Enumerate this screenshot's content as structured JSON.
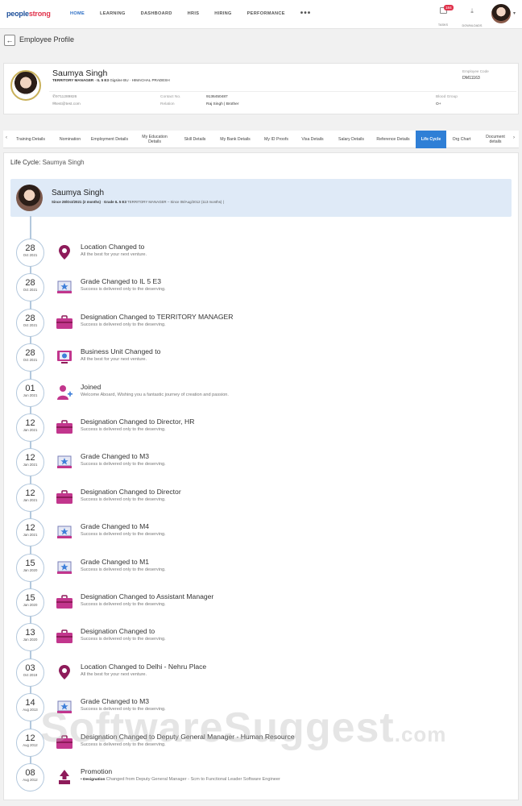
{
  "brand": {
    "logo_a": "people",
    "logo_b": "strong"
  },
  "nav": {
    "items": [
      "HOME",
      "LEARNING",
      "DASHBOARD",
      "HRIS",
      "HIRING",
      "PERFORMANCE"
    ],
    "more": "•••"
  },
  "header_actions": {
    "tasks_label": "TASKS",
    "tasks_count": "184",
    "downloads_label": "DOWNLOADS"
  },
  "page": {
    "title": "Employee Profile"
  },
  "profile": {
    "name": "Saumya Singh",
    "role": "TERRITORY MANAGER · IL 5 E3",
    "role_rest": "Gigsine BU · HIMACHAL PRADESH",
    "code_label": "Employee Code",
    "code": "DM11163",
    "phone": "9711289826",
    "email": "test@test.com",
    "contact_label": "Contact No.",
    "contact": "9136450487",
    "relation_label": "Relation",
    "relation": "Raj Singh | Brother",
    "blood_label": "Blood Group",
    "blood": "O+"
  },
  "tabs": [
    "Training Details",
    "Nomination",
    "Employment Details",
    "My Education Details",
    "Skill Details",
    "My Bank Details",
    "My ID Proofs",
    "Visa Details",
    "Salary Details",
    "Reference Details",
    "Life Cycle",
    "Org Chart",
    "Document details"
  ],
  "lifecycle": {
    "label": "Life Cycle:",
    "name": "Saumya Singh",
    "header_name": "Saumya Singh",
    "since1": "Since 28/Oct/2021 (2 months)",
    "grade": "Grade IL 5 E3",
    "designation": "TERRITORY MANAGER",
    "since2": "Since 08/Aug/2012 (113 months)"
  },
  "events": [
    {
      "day": "28",
      "mon": "Oct 2021",
      "title": "Location Changed to",
      "desc": "All the best for your next venture.",
      "icon": "location-icon"
    },
    {
      "day": "28",
      "mon": "Oct 2021",
      "title": "Grade Changed to IL 5 E3",
      "desc": "Success is delivered only to the deserving.",
      "icon": "grade-icon"
    },
    {
      "day": "28",
      "mon": "Oct 2021",
      "title": "Designation Changed to TERRITORY MANAGER",
      "desc": "Success is delivered only to the deserving.",
      "icon": "briefcase-icon"
    },
    {
      "day": "28",
      "mon": "Oct 2021",
      "title": "Business Unit Changed to",
      "desc": "All the best for your next venture.",
      "icon": "business-unit-icon"
    },
    {
      "day": "01",
      "mon": "Jun 2021",
      "title": "Joined",
      "desc": "Welcome Aboard, Wishing you a fantastic journey of creation and passion.",
      "icon": "user-add-icon"
    },
    {
      "day": "12",
      "mon": "Jan 2021",
      "title": "Designation Changed to Director, HR",
      "desc": "Success is delivered only to the deserving.",
      "icon": "briefcase-icon"
    },
    {
      "day": "12",
      "mon": "Jan 2021",
      "title": "Grade Changed to M3",
      "desc": "Success is delivered only to the deserving.",
      "icon": "grade-icon"
    },
    {
      "day": "12",
      "mon": "Jan 2021",
      "title": "Designation Changed to Director",
      "desc": "Success is delivered only to the deserving.",
      "icon": "briefcase-icon"
    },
    {
      "day": "12",
      "mon": "Jan 2021",
      "title": "Grade Changed to M4",
      "desc": "Success is delivered only to the deserving.",
      "icon": "grade-icon"
    },
    {
      "day": "15",
      "mon": "Jan 2020",
      "title": "Grade Changed to M1",
      "desc": "Success is delivered only to the deserving.",
      "icon": "grade-icon"
    },
    {
      "day": "15",
      "mon": "Jan 2020",
      "title": "Designation Changed to Assistant Manager",
      "desc": "Success is delivered only to the deserving.",
      "icon": "briefcase-icon"
    },
    {
      "day": "13",
      "mon": "Jan 2020",
      "title": "Designation Changed to",
      "desc": "Success is delivered only to the deserving.",
      "icon": "briefcase-icon"
    },
    {
      "day": "03",
      "mon": "Oct 2019",
      "title": "Location Changed to Delhi - Nehru Place",
      "desc": "All the best for your next venture.",
      "icon": "location-icon"
    },
    {
      "day": "14",
      "mon": "Aug 2013",
      "title": "Grade Changed to M3",
      "desc": "Success is delivered only to the deserving.",
      "icon": "grade-icon"
    },
    {
      "day": "12",
      "mon": "Aug 2012",
      "title": "Designation Changed to Deputy General Manager - Human Resource",
      "desc": "Success is delivered only to the deserving.",
      "icon": "briefcase-icon"
    },
    {
      "day": "08",
      "mon": "Aug 2012",
      "title": "Promotion",
      "desc_label": "Designation",
      "desc": "Changed from   Deputy General Manager - Scm   to   Functional Leader Software Engineer",
      "icon": "promotion-icon"
    }
  ],
  "watermark": {
    "text": "SoftwareSuggest",
    "suffix": ".com"
  }
}
